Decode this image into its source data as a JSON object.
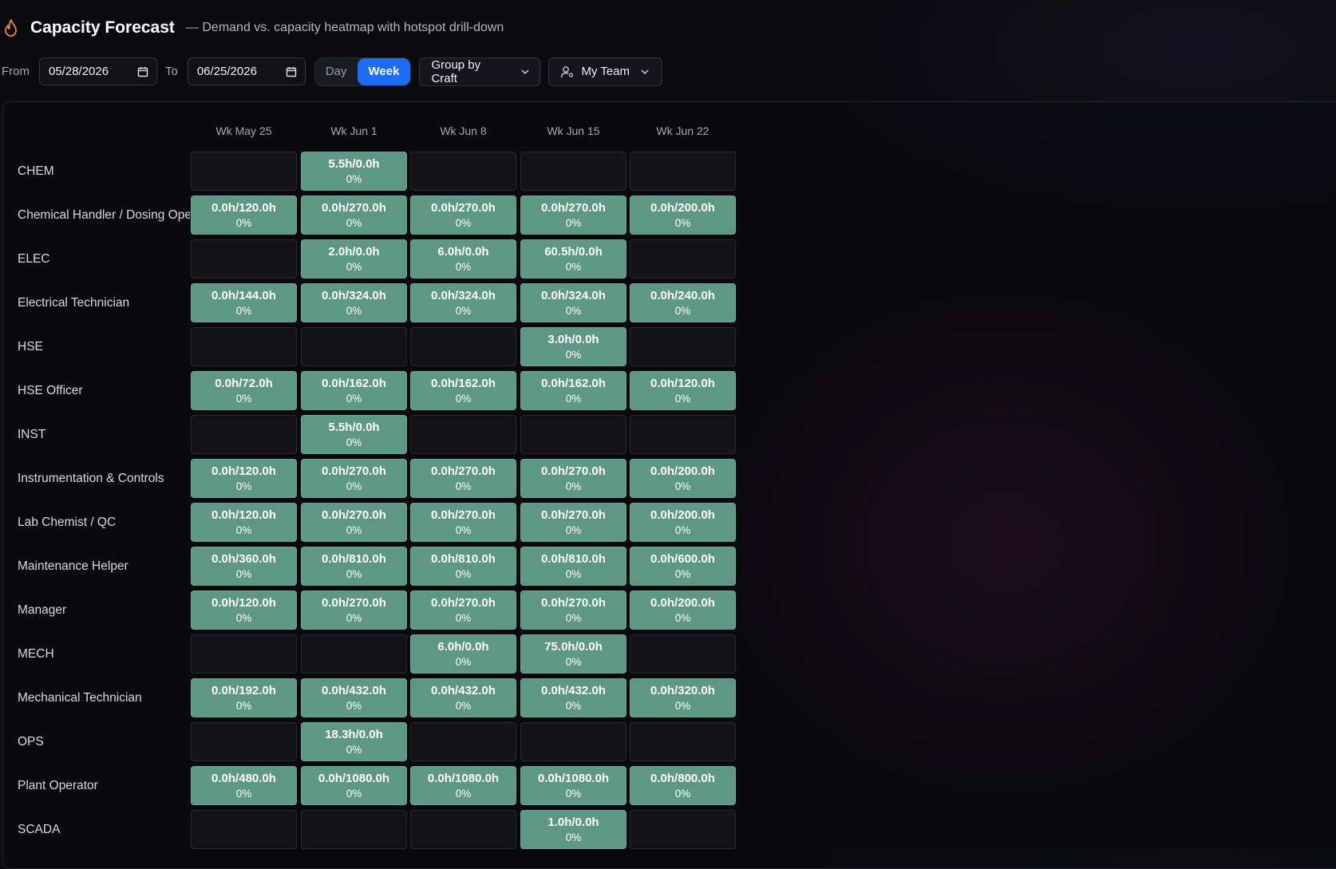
{
  "header": {
    "title": "Capacity Forecast",
    "subtitle": "— Demand vs. capacity heatmap with hotspot drill-down",
    "icon": "flame-icon"
  },
  "toolbar": {
    "from_label": "From",
    "from_value": "05/28/2026",
    "to_label": "To",
    "to_value": "06/25/2026",
    "granularity_options": [
      "Day",
      "Week"
    ],
    "granularity_selected": "Week",
    "group_by": "Group by Craft",
    "team_filter": "My Team"
  },
  "heatmap": {
    "columns": [
      "Wk May 25",
      "Wk Jun 1",
      "Wk Jun 8",
      "Wk Jun 15",
      "Wk Jun 22"
    ],
    "rows": [
      {
        "label": "CHEM",
        "cells": [
          null,
          {
            "v": "5.5h/0.0h",
            "p": "0%"
          },
          null,
          null,
          null
        ]
      },
      {
        "label": "Chemical Handler / Dosing Operator",
        "cells": [
          {
            "v": "0.0h/120.0h",
            "p": "0%"
          },
          {
            "v": "0.0h/270.0h",
            "p": "0%"
          },
          {
            "v": "0.0h/270.0h",
            "p": "0%"
          },
          {
            "v": "0.0h/270.0h",
            "p": "0%"
          },
          {
            "v": "0.0h/200.0h",
            "p": "0%"
          }
        ]
      },
      {
        "label": "ELEC",
        "cells": [
          null,
          {
            "v": "2.0h/0.0h",
            "p": "0%"
          },
          {
            "v": "6.0h/0.0h",
            "p": "0%"
          },
          {
            "v": "60.5h/0.0h",
            "p": "0%"
          },
          null
        ]
      },
      {
        "label": "Electrical Technician",
        "cells": [
          {
            "v": "0.0h/144.0h",
            "p": "0%"
          },
          {
            "v": "0.0h/324.0h",
            "p": "0%"
          },
          {
            "v": "0.0h/324.0h",
            "p": "0%"
          },
          {
            "v": "0.0h/324.0h",
            "p": "0%"
          },
          {
            "v": "0.0h/240.0h",
            "p": "0%"
          }
        ]
      },
      {
        "label": "HSE",
        "cells": [
          null,
          null,
          null,
          {
            "v": "3.0h/0.0h",
            "p": "0%"
          },
          null
        ]
      },
      {
        "label": "HSE Officer",
        "cells": [
          {
            "v": "0.0h/72.0h",
            "p": "0%"
          },
          {
            "v": "0.0h/162.0h",
            "p": "0%"
          },
          {
            "v": "0.0h/162.0h",
            "p": "0%"
          },
          {
            "v": "0.0h/162.0h",
            "p": "0%"
          },
          {
            "v": "0.0h/120.0h",
            "p": "0%"
          }
        ]
      },
      {
        "label": "INST",
        "cells": [
          null,
          {
            "v": "5.5h/0.0h",
            "p": "0%"
          },
          null,
          null,
          null
        ]
      },
      {
        "label": "Instrumentation & Controls",
        "cells": [
          {
            "v": "0.0h/120.0h",
            "p": "0%"
          },
          {
            "v": "0.0h/270.0h",
            "p": "0%"
          },
          {
            "v": "0.0h/270.0h",
            "p": "0%"
          },
          {
            "v": "0.0h/270.0h",
            "p": "0%"
          },
          {
            "v": "0.0h/200.0h",
            "p": "0%"
          }
        ]
      },
      {
        "label": "Lab Chemist / QC",
        "cells": [
          {
            "v": "0.0h/120.0h",
            "p": "0%"
          },
          {
            "v": "0.0h/270.0h",
            "p": "0%"
          },
          {
            "v": "0.0h/270.0h",
            "p": "0%"
          },
          {
            "v": "0.0h/270.0h",
            "p": "0%"
          },
          {
            "v": "0.0h/200.0h",
            "p": "0%"
          }
        ]
      },
      {
        "label": "Maintenance Helper",
        "cells": [
          {
            "v": "0.0h/360.0h",
            "p": "0%"
          },
          {
            "v": "0.0h/810.0h",
            "p": "0%"
          },
          {
            "v": "0.0h/810.0h",
            "p": "0%"
          },
          {
            "v": "0.0h/810.0h",
            "p": "0%"
          },
          {
            "v": "0.0h/600.0h",
            "p": "0%"
          }
        ]
      },
      {
        "label": "Manager",
        "cells": [
          {
            "v": "0.0h/120.0h",
            "p": "0%"
          },
          {
            "v": "0.0h/270.0h",
            "p": "0%"
          },
          {
            "v": "0.0h/270.0h",
            "p": "0%"
          },
          {
            "v": "0.0h/270.0h",
            "p": "0%"
          },
          {
            "v": "0.0h/200.0h",
            "p": "0%"
          }
        ]
      },
      {
        "label": "MECH",
        "cells": [
          null,
          null,
          {
            "v": "6.0h/0.0h",
            "p": "0%"
          },
          {
            "v": "75.0h/0.0h",
            "p": "0%"
          },
          null
        ]
      },
      {
        "label": "Mechanical Technician",
        "cells": [
          {
            "v": "0.0h/192.0h",
            "p": "0%"
          },
          {
            "v": "0.0h/432.0h",
            "p": "0%"
          },
          {
            "v": "0.0h/432.0h",
            "p": "0%"
          },
          {
            "v": "0.0h/432.0h",
            "p": "0%"
          },
          {
            "v": "0.0h/320.0h",
            "p": "0%"
          }
        ]
      },
      {
        "label": "OPS",
        "cells": [
          null,
          {
            "v": "18.3h/0.0h",
            "p": "0%"
          },
          null,
          null,
          null
        ]
      },
      {
        "label": "Plant Operator",
        "cells": [
          {
            "v": "0.0h/480.0h",
            "p": "0%"
          },
          {
            "v": "0.0h/1080.0h",
            "p": "0%"
          },
          {
            "v": "0.0h/1080.0h",
            "p": "0%"
          },
          {
            "v": "0.0h/1080.0h",
            "p": "0%"
          },
          {
            "v": "0.0h/800.0h",
            "p": "0%"
          }
        ]
      },
      {
        "label": "SCADA",
        "cells": [
          null,
          null,
          null,
          {
            "v": "1.0h/0.0h",
            "p": "0%"
          },
          null
        ]
      }
    ]
  },
  "colors": {
    "background": "#0b0b0f",
    "accent": "#1d6cf5",
    "cell_filled": "#5e9884",
    "cell_empty": "#121217",
    "flame": "#f08a24"
  }
}
